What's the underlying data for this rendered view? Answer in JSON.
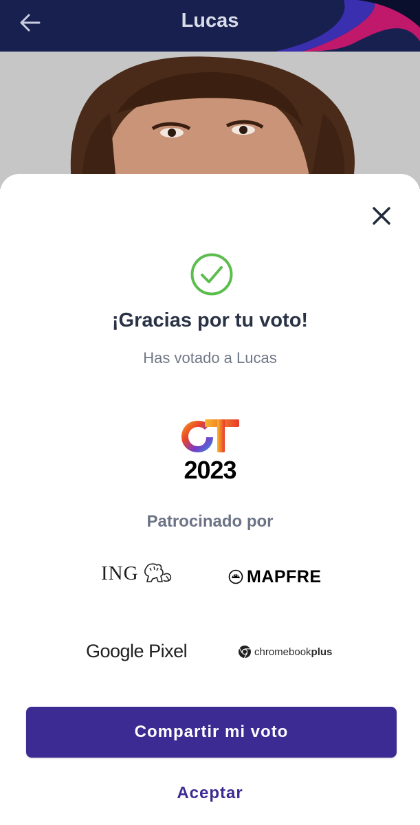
{
  "appbar": {
    "title": "Lucas",
    "back_icon": "arrow-left-icon",
    "colors": {
      "background": "#182050",
      "swoosh_blue": "#3a2fae",
      "swoosh_magenta": "#c0186a"
    }
  },
  "photo": {
    "alt": "Lucas"
  },
  "sheet": {
    "close_icon": "close-icon",
    "check_icon": "check-circle-icon",
    "check_color": "#5cbd4e",
    "title": "¡Gracias por tu voto!",
    "subtitle": "Has votado a Lucas",
    "logo": {
      "letters": "OT",
      "year": "2023"
    },
    "sponsored_label": "Patrocinado por",
    "sponsors": {
      "ing": {
        "name": "ING",
        "icon": "lion-icon"
      },
      "mapfre": {
        "name": "MAPFRE",
        "icon": "mapfre-emblem-icon"
      },
      "google_pixel": {
        "name": "Google Pixel"
      },
      "chromebook": {
        "name_light": "chromebook",
        "name_bold": "plus",
        "icon": "chrome-icon"
      }
    },
    "share_button": "Compartir mi voto",
    "accept_button": "Aceptar",
    "accent_color": "#3b2b93"
  }
}
